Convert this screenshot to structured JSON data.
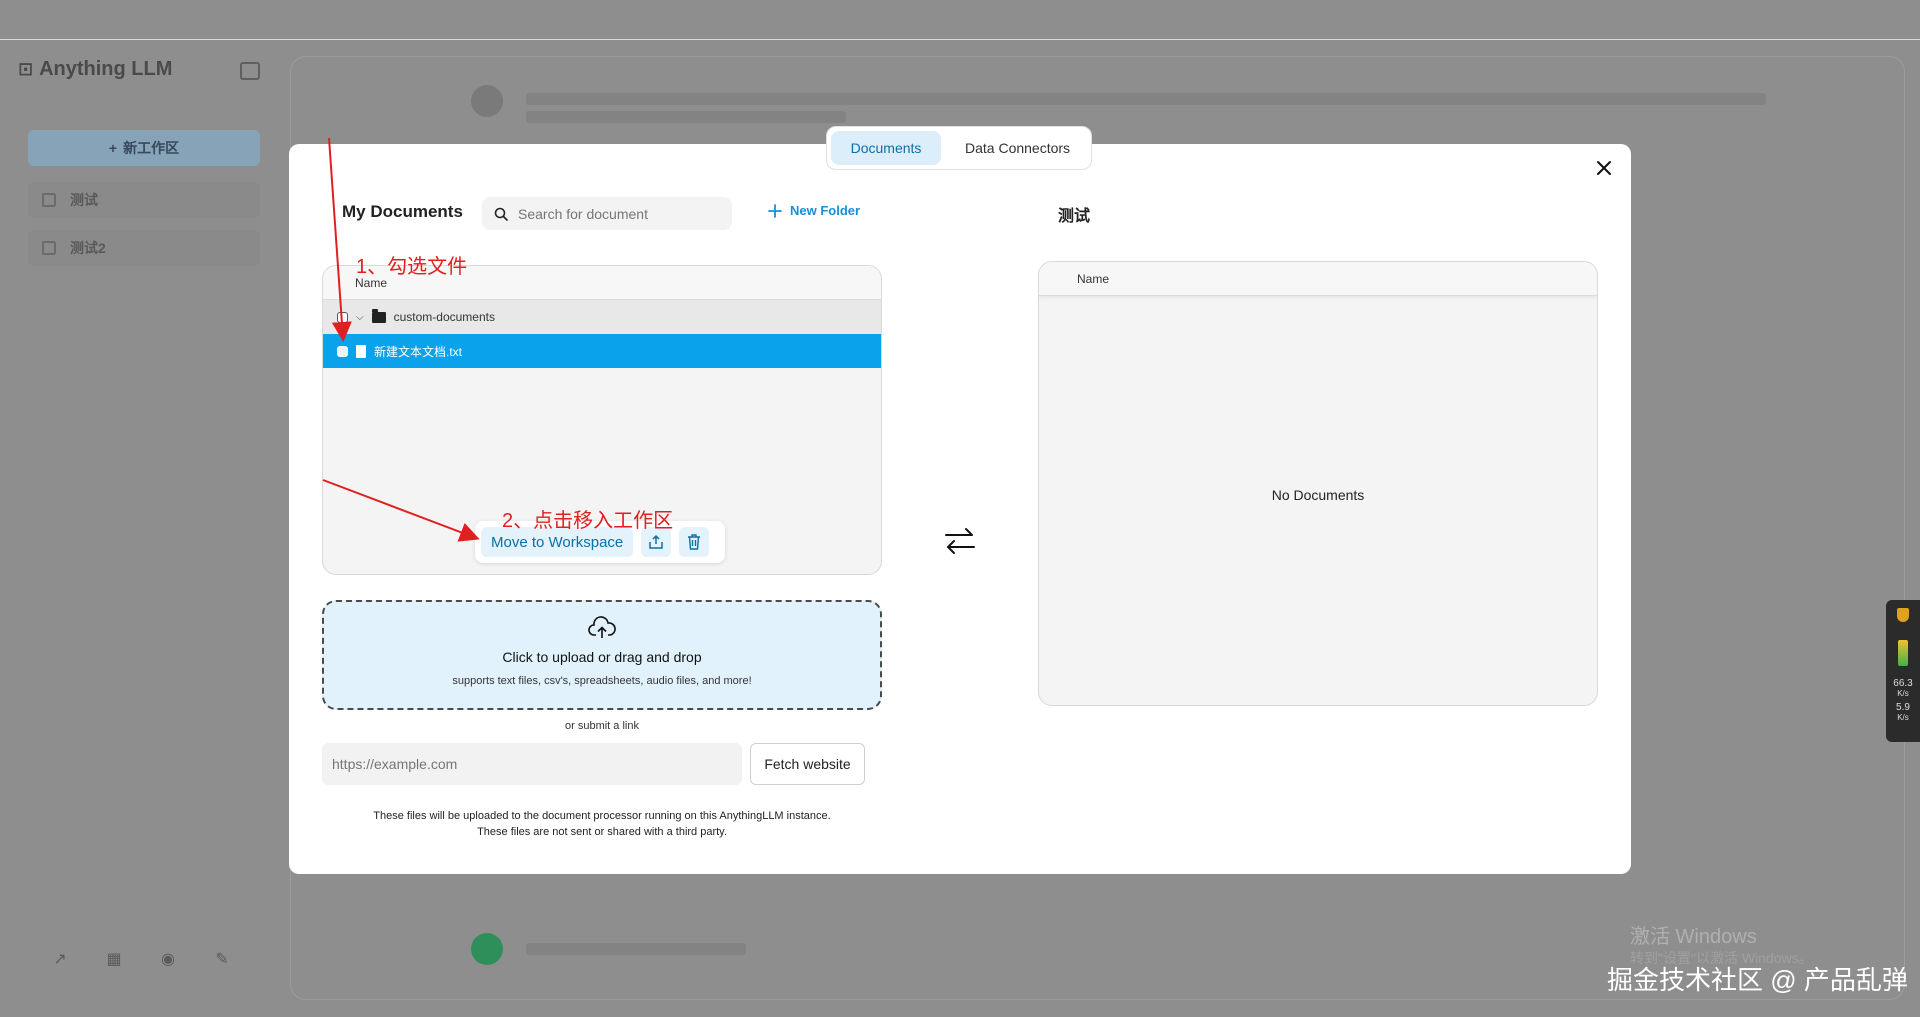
{
  "background": {
    "logo": "Anything LLM",
    "new_workspace_label": "新工作区",
    "workspaces": [
      "测试",
      "测试2"
    ]
  },
  "modal": {
    "tabs": [
      "Documents",
      "Data Connectors"
    ],
    "my_documents": {
      "title": "My Documents",
      "search_placeholder": "Search for document",
      "new_folder_label": "New Folder",
      "column_name": "Name",
      "folder": "custom-documents",
      "file": "新建文本文档.txt",
      "move_button": "Move to Workspace"
    },
    "upload": {
      "title": "Click to upload or drag and drop",
      "subtitle": "supports text files, csv's, spreadsheets, audio files, and more!",
      "or_link": "or submit a link",
      "url_placeholder": "https://example.com",
      "fetch_button": "Fetch website",
      "disclaimer_1": "These files will be uploaded to the document processor running on this AnythingLLM instance.",
      "disclaimer_2": "These files are not sent or shared with a third party."
    },
    "workspace": {
      "title": "测试",
      "column_name": "Name",
      "empty": "No Documents"
    }
  },
  "annotations": {
    "step1": "1、勾选文件",
    "step2": "2、点击移入工作区"
  },
  "watermarks": {
    "windows": "激活 Windows",
    "windows_sub": "转到\"设置\"以激活 Windows。",
    "juejin": "掘金技术社区 @ 产品乱弹"
  },
  "side_widget": {
    "upload_speed": "66.3",
    "download_speed": "5.9",
    "unit": "K/s"
  },
  "colors": {
    "accent": "#0aa2ea",
    "annotation": "#e02020"
  }
}
